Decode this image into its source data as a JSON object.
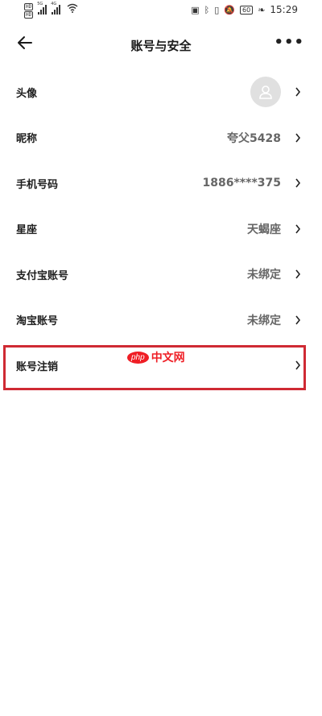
{
  "status_bar": {
    "sim1": "HD",
    "sim2": "HD",
    "net1": "5G",
    "net2": "4G",
    "battery": "60",
    "time": "15:29"
  },
  "header": {
    "title": "账号与安全",
    "back_icon": "arrow-left-icon",
    "more_icon": "more-dots-icon",
    "more_label": "•••"
  },
  "rows": [
    {
      "label": "头像",
      "value": ""
    },
    {
      "label": "昵称",
      "value": "夸父5428"
    },
    {
      "label": "手机号码",
      "value": "1886****375"
    },
    {
      "label": "星座",
      "value": "天蝎座"
    },
    {
      "label": "支付宝账号",
      "value": "未绑定"
    },
    {
      "label": "淘宝账号",
      "value": "未绑定"
    },
    {
      "label": "账号注销",
      "value": ""
    }
  ],
  "watermark": {
    "logo": "php",
    "text": "中文网"
  },
  "colors": {
    "highlight": "#cf2a33",
    "watermark": "#ef1e25",
    "value_text": "#666666"
  }
}
